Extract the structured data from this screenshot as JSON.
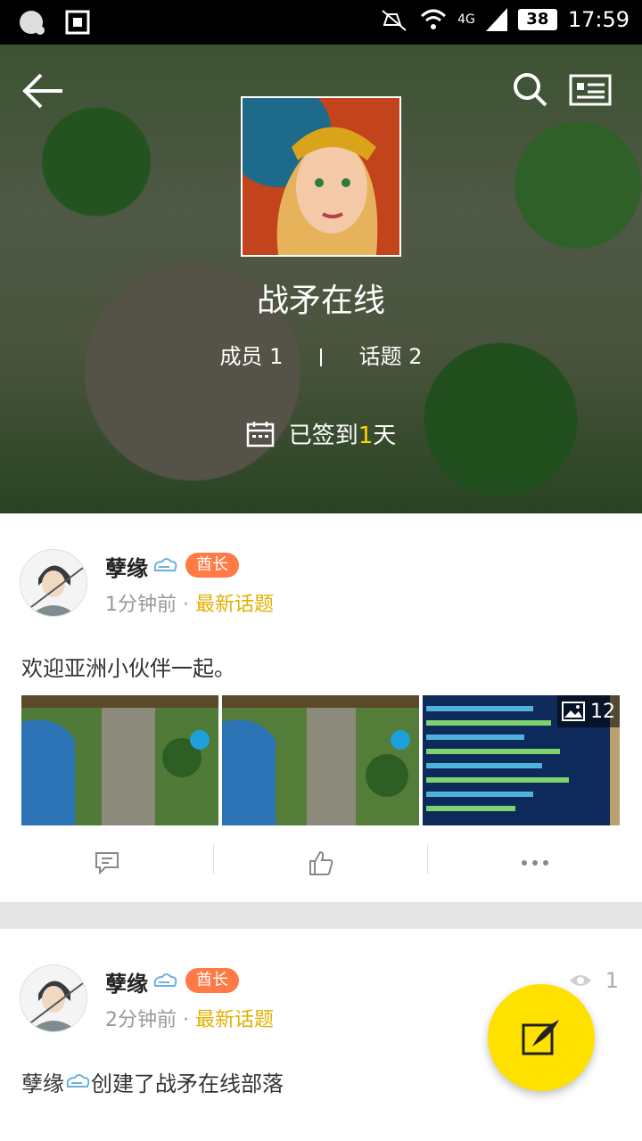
{
  "status_bar": {
    "time": "17:59",
    "battery": "38",
    "network": "4G",
    "icons": [
      "chat-bubble-icon",
      "screenshot-icon",
      "mute-icon",
      "wifi-icon",
      "signal-icon",
      "battery-icon"
    ]
  },
  "header": {
    "group_name": "战矛在线",
    "members_label": "成员",
    "members_count": "1",
    "topics_label": "话题",
    "topics_count": "2",
    "checkin_prefix": "已签到",
    "checkin_days": "1",
    "checkin_suffix": "天"
  },
  "posts": [
    {
      "username": "孽缘",
      "badge": "酋长",
      "time": "1分钟前",
      "dot": "·",
      "tag": "最新话题",
      "content": "欢迎亚洲小伙伴一起。",
      "image_count": "12"
    },
    {
      "username": "孽缘",
      "badge": "酋长",
      "time": "2分钟前",
      "dot": "·",
      "tag": "最新话题",
      "views": "1",
      "content_name": "孽缘",
      "content_rest": "创建了战矛在线部落"
    }
  ],
  "colors": {
    "accent_yellow": "#ffe100",
    "badge_orange": "#ff7a45",
    "tag_yellow": "#e2b100"
  }
}
